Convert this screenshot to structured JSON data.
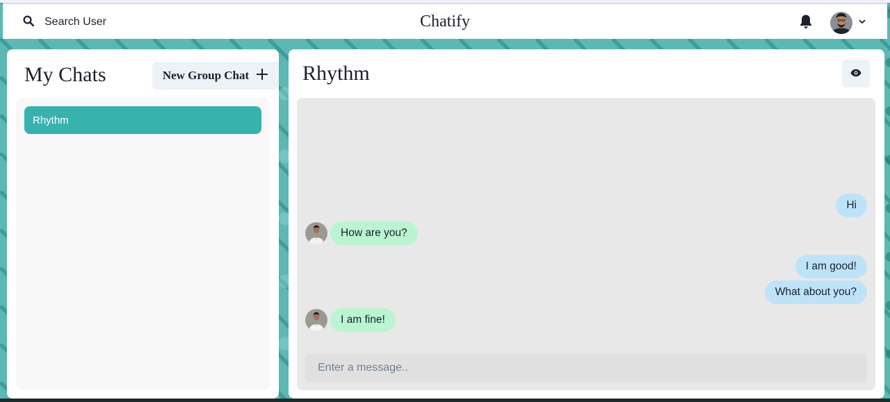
{
  "header": {
    "search_label": "Search User",
    "app_title": "Chatify",
    "bell_icon": "bell-icon",
    "search_icon": "search-icon"
  },
  "left": {
    "title": "My Chats",
    "new_group_label": "New Group Chat",
    "new_group_icon": "plus-icon",
    "chats": [
      {
        "name": "Rhythm",
        "selected": true
      }
    ]
  },
  "chat": {
    "title": "Rhythm",
    "view_icon": "eye-icon",
    "messages": [
      {
        "text": "Hi",
        "sender": "me"
      },
      {
        "text": "How are you?",
        "sender": "other"
      },
      {
        "text": "I am good!",
        "sender": "me"
      },
      {
        "text": "What about you?",
        "sender": "me"
      },
      {
        "text": "I am fine!",
        "sender": "other"
      }
    ],
    "input_placeholder": "Enter a message.."
  },
  "colors": {
    "accent": "#38b2ac",
    "sent_bubble": "#bee3f8",
    "received_bubble": "#b9f5d0"
  }
}
